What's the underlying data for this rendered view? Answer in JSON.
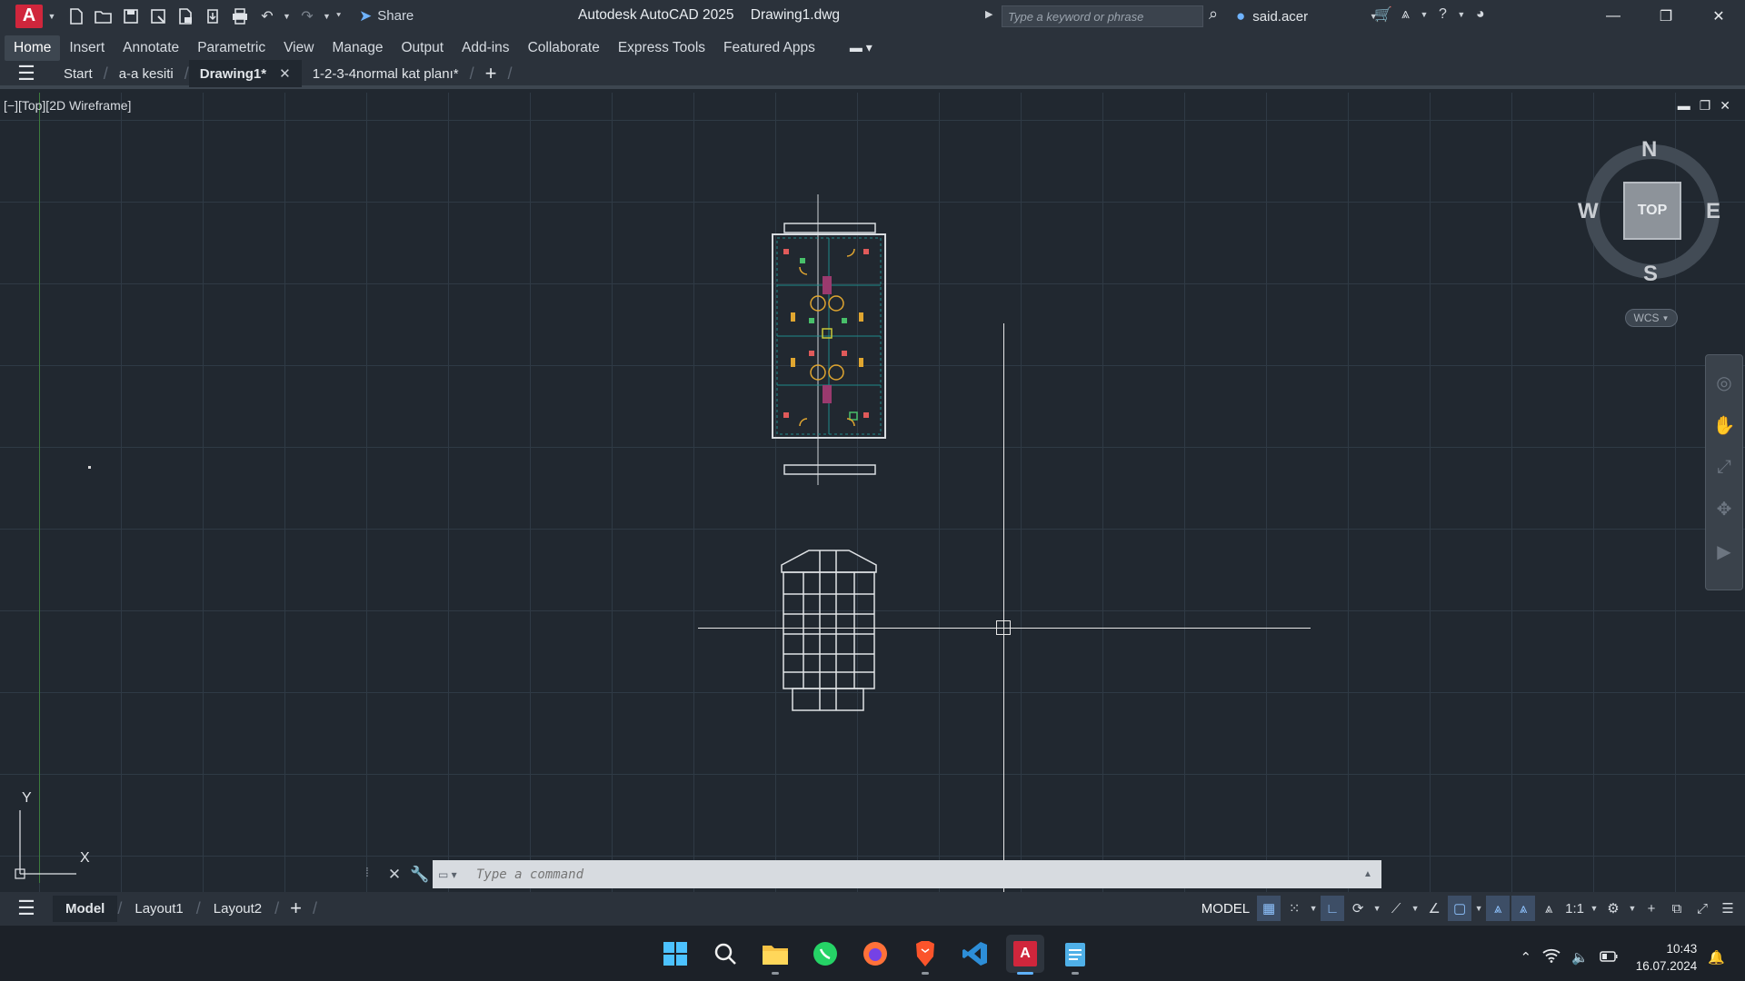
{
  "titlebar": {
    "app_name": "Autodesk AutoCAD 2025",
    "file_name": "Drawing1.dwg",
    "share_label": "Share",
    "search_placeholder": "Type a keyword or phrase",
    "user_name": "said.acer"
  },
  "ribbon": {
    "tabs": [
      "Home",
      "Insert",
      "Annotate",
      "Parametric",
      "View",
      "Manage",
      "Output",
      "Add-ins",
      "Collaborate",
      "Express Tools",
      "Featured Apps"
    ],
    "active": "Home"
  },
  "documents": {
    "tabs": [
      {
        "label": "Start"
      },
      {
        "label": "a-a kesiti"
      },
      {
        "label": "Drawing1*"
      },
      {
        "label": "1-2-3-4normal kat planı*"
      }
    ],
    "active": "Drawing1*"
  },
  "viewport": {
    "label": "[−][Top][2D Wireframe]"
  },
  "viewcube": {
    "top": "TOP",
    "north": "N",
    "south": "S",
    "east": "E",
    "west": "W",
    "wcs": "WCS"
  },
  "ucs": {
    "x": "X",
    "y": "Y"
  },
  "command_line": {
    "placeholder": "Type a command"
  },
  "layouts": {
    "tabs": [
      "Model",
      "Layout1",
      "Layout2"
    ],
    "active": "Model"
  },
  "status": {
    "space": "MODEL",
    "scale": "1:1"
  },
  "taskbar": {
    "icons": [
      "windows-start",
      "search",
      "file-explorer",
      "whatsapp",
      "firefox",
      "brave",
      "vscode",
      "autocad",
      "notepad"
    ],
    "active": "autocad",
    "time": "10:43",
    "date": "16.07.2024"
  },
  "colors": {
    "accent": "#d0263c",
    "background": "#212830",
    "chrome": "#2b323b"
  }
}
